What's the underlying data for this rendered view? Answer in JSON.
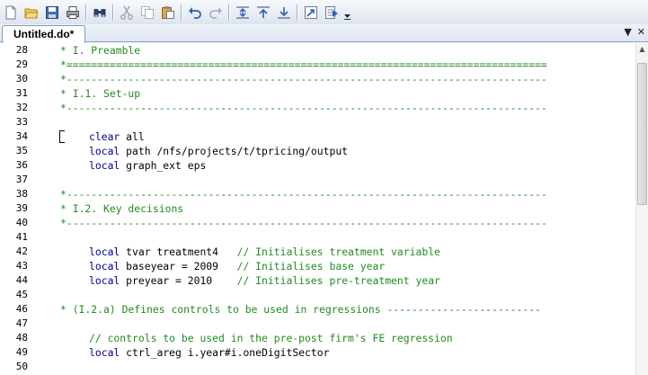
{
  "toolbar": {
    "buttons": [
      {
        "name": "new-file-icon"
      },
      {
        "name": "open-folder-icon"
      },
      {
        "name": "save-icon"
      },
      {
        "name": "print-icon"
      },
      {
        "name": "find-icon"
      },
      {
        "name": "cut-icon"
      },
      {
        "name": "copy-icon"
      },
      {
        "name": "paste-icon"
      },
      {
        "name": "undo-icon"
      },
      {
        "name": "redo-icon"
      },
      {
        "name": "indent-icon"
      },
      {
        "name": "move-up-icon"
      },
      {
        "name": "move-down-icon"
      },
      {
        "name": "goto-icon"
      },
      {
        "name": "run-icon"
      }
    ]
  },
  "tab": {
    "label": "Untitled.do*"
  },
  "tab_controls": {
    "dropdown": "▼",
    "close": "✕"
  },
  "editor": {
    "lines": [
      {
        "num": "28",
        "indent": false,
        "segs": [
          {
            "t": "* I. Preamble",
            "c": "cm"
          }
        ]
      },
      {
        "num": "29",
        "indent": false,
        "segs": [
          {
            "t": "*==============================================================================",
            "c": "cm"
          }
        ]
      },
      {
        "num": "30",
        "indent": false,
        "segs": [
          {
            "t": "*------------------------------------------------------------------------------",
            "c": "cm"
          }
        ]
      },
      {
        "num": "31",
        "indent": false,
        "segs": [
          {
            "t": "* I.1. Set-up",
            "c": "cm"
          }
        ]
      },
      {
        "num": "32",
        "indent": false,
        "segs": [
          {
            "t": "*------------------------------------------------------------------------------",
            "c": "cm"
          }
        ]
      },
      {
        "num": "33",
        "indent": false,
        "segs": []
      },
      {
        "num": "34",
        "indent": true,
        "segs": [
          {
            "t": "clear",
            "c": "kw"
          },
          {
            "t": " all",
            "c": "tx"
          }
        ]
      },
      {
        "num": "35",
        "indent": true,
        "segs": [
          {
            "t": "local",
            "c": "kw"
          },
          {
            "t": " path /nfs/projects/t/tpricing/output",
            "c": "tx"
          }
        ]
      },
      {
        "num": "36",
        "indent": true,
        "segs": [
          {
            "t": "local",
            "c": "kw"
          },
          {
            "t": " graph_ext eps",
            "c": "tx"
          }
        ]
      },
      {
        "num": "37",
        "indent": false,
        "segs": []
      },
      {
        "num": "38",
        "indent": false,
        "segs": [
          {
            "t": "*------------------------------------------------------------------------------",
            "c": "cm"
          }
        ]
      },
      {
        "num": "39",
        "indent": false,
        "segs": [
          {
            "t": "* I.2. Key decisions",
            "c": "cm"
          }
        ]
      },
      {
        "num": "40",
        "indent": false,
        "segs": [
          {
            "t": "*------------------------------------------------------------------------------",
            "c": "cm"
          }
        ]
      },
      {
        "num": "41",
        "indent": false,
        "segs": []
      },
      {
        "num": "42",
        "indent": true,
        "segs": [
          {
            "t": "local",
            "c": "kw"
          },
          {
            "t": " tvar treatment4   ",
            "c": "tx"
          },
          {
            "t": "// Initialises treatment variable",
            "c": "cm"
          }
        ]
      },
      {
        "num": "43",
        "indent": true,
        "segs": [
          {
            "t": "local",
            "c": "kw"
          },
          {
            "t": " baseyear = 2009   ",
            "c": "tx"
          },
          {
            "t": "// Initialises base year",
            "c": "cm"
          }
        ]
      },
      {
        "num": "44",
        "indent": true,
        "segs": [
          {
            "t": "local",
            "c": "kw"
          },
          {
            "t": " preyear = 2010    ",
            "c": "tx"
          },
          {
            "t": "// Initialises pre-treatment year",
            "c": "cm"
          }
        ]
      },
      {
        "num": "45",
        "indent": false,
        "segs": []
      },
      {
        "num": "46",
        "indent": false,
        "segs": [
          {
            "t": "* (I.2.a) Defines controls to be used in regressions -------------------------",
            "c": "cm"
          }
        ]
      },
      {
        "num": "47",
        "indent": false,
        "segs": []
      },
      {
        "num": "48",
        "indent": true,
        "segs": [
          {
            "t": "// controls to be used in the pre-post firm's FE regression",
            "c": "cm"
          }
        ]
      },
      {
        "num": "49",
        "indent": true,
        "segs": [
          {
            "t": "local",
            "c": "kw"
          },
          {
            "t": " ctrl_areg i.year#i.oneDigitSector",
            "c": "tx"
          }
        ]
      },
      {
        "num": "50",
        "indent": false,
        "segs": []
      }
    ]
  },
  "scrollbar": {
    "up_arrow": "▲"
  }
}
